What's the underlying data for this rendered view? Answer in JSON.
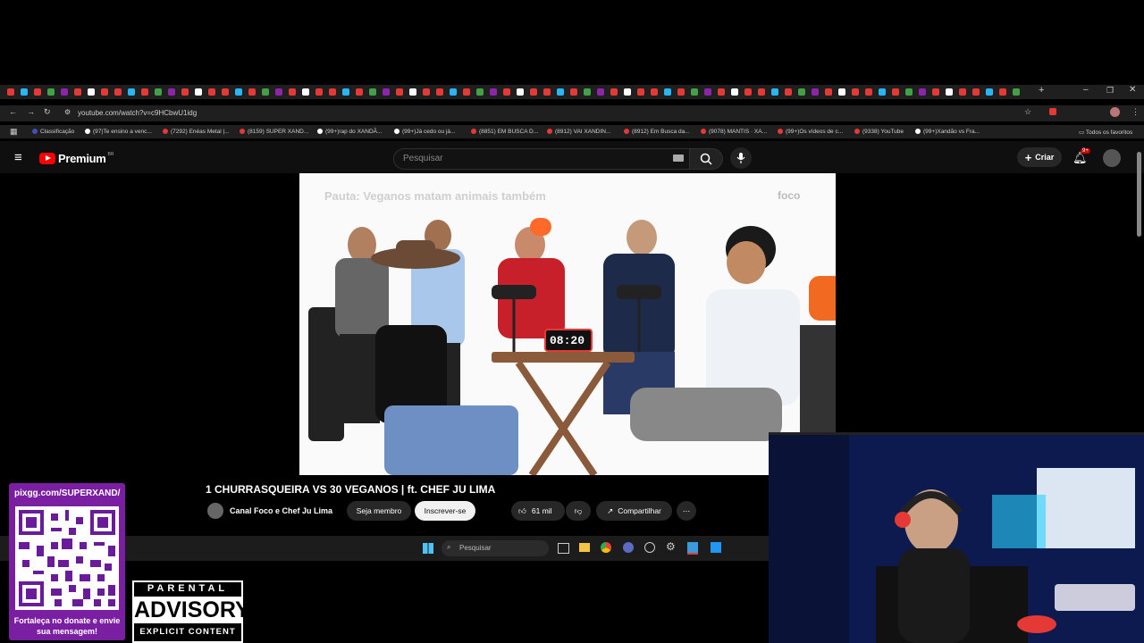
{
  "browser": {
    "url": "youtube.com/watch?v=c9HCbwU1idg",
    "bookmarks": [
      "Classificação",
      "(97)Te ensino a venc...",
      "(7292) Enéas Metal |...",
      "(8159) SUPER XAND...",
      "(99+)rap do XANDÃ...",
      "(99+)Já cedo ou já...",
      "(8851) EM BUSCA D...",
      "(8912) VAI XANDIN...",
      "(8912) Em Busca da...",
      "(9078) MANTIS · XA...",
      "(99+)Os vídeos de c...",
      "(9338) YouTube",
      "(99+)Xandão vs Fra..."
    ],
    "all_favorites": "Todos os favoritos"
  },
  "youtube": {
    "logo": "Premium",
    "region": "BR",
    "search_placeholder": "Pesquisar",
    "create_label": "Criar",
    "notifications_badge": "9+"
  },
  "video": {
    "overlay_title": "Pauta: Veganos matam animais também",
    "brand": "foco",
    "timer": "08:20",
    "title": "1 CHURRASQUEIRA VS 30 VEGANOS | ft. CHEF JU LIMA",
    "channel": "Canal Foco e Chef Ju Lima",
    "join_label": "Seja membro",
    "subscribe_label": "Inscrever-se",
    "likes": "61 mil",
    "share_label": "Compartilhar"
  },
  "taskbar": {
    "search_placeholder": "Pesquisar"
  },
  "overlay": {
    "pix_url": "pixgg.com/SUPERXAND/",
    "cta": "Fortaleça no donate e envie sua mensagem!",
    "advisory_top": "PARENTAL",
    "advisory_mid": "ADVISORY",
    "advisory_bottom": "EXPLICIT CONTENT"
  }
}
